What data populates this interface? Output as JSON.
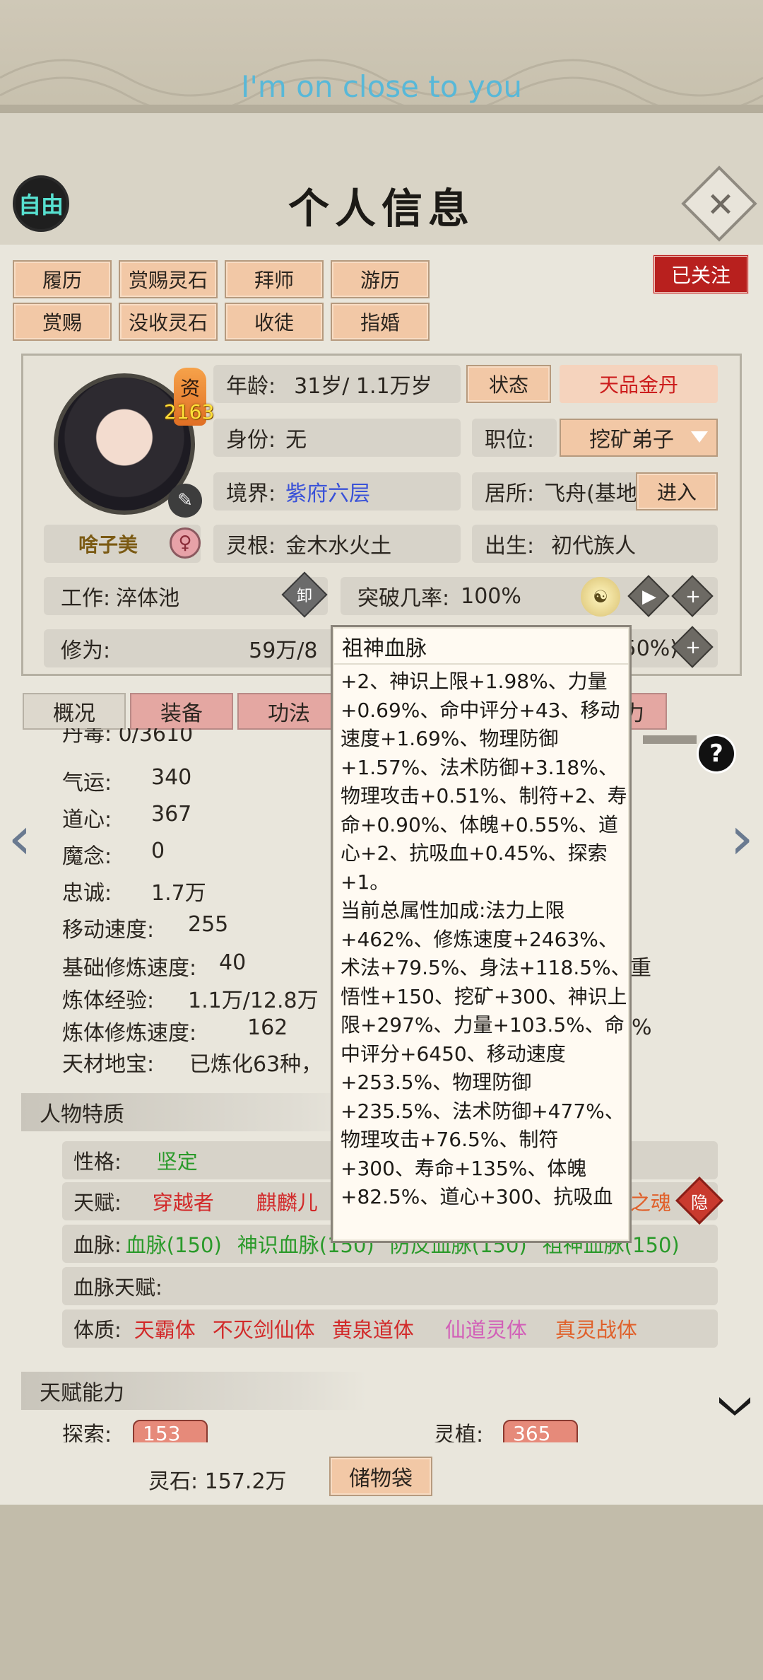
{
  "subtitle": "I'm on close to you",
  "header": {
    "badge": "自由",
    "title": "个人信息",
    "close": "✕"
  },
  "actions": {
    "row1": [
      "履历",
      "赏赐灵石",
      "拜师",
      "游历"
    ],
    "row2": [
      "赏赐",
      "没收灵石",
      "收徒",
      "指婚"
    ],
    "followed": "已关注"
  },
  "profile": {
    "aptitude_label": "资",
    "aptitude_value": "2163",
    "name": "啥子美",
    "gender_icon": "♀",
    "age_label": "年龄:",
    "age_value": "31岁/ 1.1万岁",
    "state_button": "状态",
    "realm_grade": "天品金丹",
    "identity_label": "身份:",
    "identity_value": "无",
    "position_label": "职位:",
    "position_value": "挖矿弟子",
    "level_label": "境界:",
    "level_value": "紫府六层",
    "residence_label": "居所:",
    "residence_value": "飞舟(基地",
    "enter_button": "进入",
    "root_label": "灵根:",
    "root_value": "金木水火土",
    "birth_label": "出生:",
    "birth_value": "初代族人",
    "work_label": "工作:",
    "work_value": "淬体池",
    "resign_icon_text": "卸",
    "break_label": "突破几率:",
    "break_value": "100%",
    "cultivation_label": "修为:",
    "cultivation_value": "59万/8",
    "cultivation_pct": "50%)"
  },
  "tabs": [
    "概况",
    "装备",
    "功法",
    "",
    "",
    "力"
  ],
  "stats": {
    "partial_top": "丹毒:    0/3610",
    "luck_label": "气运:",
    "luck_value": "340",
    "dao_label": "道心:",
    "dao_value": "367",
    "demon_label": "魔念:",
    "demon_value": "0",
    "loyalty_label": "忠诚:",
    "loyalty_value": "1.7万",
    "move_label": "移动速度:",
    "move_value": "255",
    "base_speed_label": "基础修炼速度:",
    "base_speed_value": "40",
    "body_exp_label": "炼体经验:",
    "body_exp_value": "1.1万/12.8万",
    "body_speed_label": "炼体修炼速度:",
    "body_speed_value": "162",
    "treasure_label": "天材地宝:",
    "treasure_value": "已炼化63种，",
    "right_frag_1": "重",
    "right_frag_2": "%"
  },
  "traits_section": {
    "title": "人物特质",
    "personality_label": "性格:",
    "personality_value": "坚定",
    "talent_label": "天赋:",
    "talents": [
      "穿越者",
      "麒麟儿"
    ],
    "talent_tail": "之魂",
    "hidden_icon_text": "隐",
    "blood_label": "血脉:",
    "blood_items": [
      "血脉(150)",
      "神识血脉(150)",
      "防反血脉(150)",
      "祖神血脉(150)"
    ],
    "blood_talent_label": "血脉天赋:",
    "physique_label": "体质:",
    "physiques": [
      "天霸体",
      "不灭剑仙体",
      "黄泉道体",
      "仙道灵体",
      "真灵战体"
    ]
  },
  "ability_section": {
    "title": "天赋能力",
    "explore_label": "探索:",
    "explore_value": "153",
    "plant_label": "灵植:",
    "plant_value": "365"
  },
  "footer": {
    "stones_label": "灵石: 157.2万",
    "bag_button": "储物袋"
  },
  "tooltip": {
    "title": "祖神血脉",
    "lines": [
      "+2、神识上限+1.98%、力量",
      "+0.69%、命中评分+43、移动",
      "速度+1.69%、物理防御",
      "+1.57%、法术防御+3.18%、",
      "物理攻击+0.51%、制符+2、寿",
      "命+0.90%、体魄+0.55%、道",
      "心+2、抗吸血+0.45%、探索",
      "+1。",
      "当前总属性加成:法力上限",
      "+462%、修炼速度+2463%、",
      "术法+79.5%、身法+118.5%、",
      "悟性+150、挖矿+300、神识上",
      "限+297%、力量+103.5%、命",
      "中评分+6450、移动速度",
      "+253.5%、物理防御",
      "+235.5%、法术防御+477%、",
      "物理攻击+76.5%、制符",
      "+300、寿命+135%、体魄",
      "+82.5%、道心+300、抗吸血"
    ]
  },
  "colors": {
    "accent_red": "#cc1d1d",
    "blue_level": "#3a52d8",
    "green": "#2a9a2a",
    "pink": "#d25fb8",
    "orange": "#e0602a"
  }
}
